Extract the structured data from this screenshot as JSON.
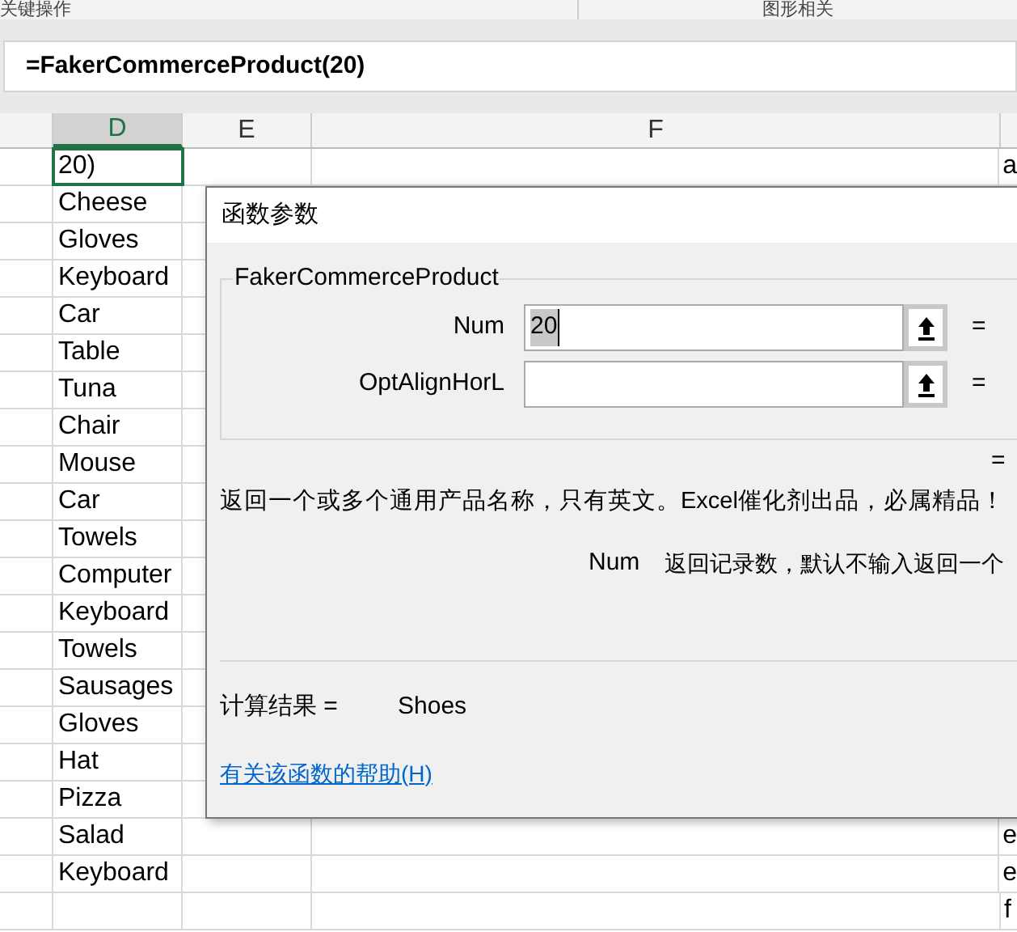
{
  "ribbon_groups": [
    "关键操作",
    "图形相关"
  ],
  "formula_bar": {
    "value": "=FakerCommerceProduct(20)"
  },
  "columns": [
    {
      "label": "D",
      "selected": true
    },
    {
      "label": "E",
      "selected": false
    },
    {
      "label": "F",
      "selected": false
    }
  ],
  "rows": [
    {
      "column_d": "20)",
      "column_g": "a",
      "selected": true
    },
    {
      "column_d": "Cheese",
      "selected": false
    },
    {
      "column_d": "Gloves",
      "selected": false
    },
    {
      "column_d": "Keyboard",
      "selected": false
    },
    {
      "column_d": "Car",
      "selected": false
    },
    {
      "column_d": "Table",
      "selected": false
    },
    {
      "column_d": "Tuna",
      "selected": false
    },
    {
      "column_d": "Chair",
      "selected": false
    },
    {
      "column_d": "Mouse",
      "selected": false
    },
    {
      "column_d": "Car",
      "selected": false
    },
    {
      "column_d": "Towels",
      "selected": false
    },
    {
      "column_d": "Computer",
      "selected": false
    },
    {
      "column_d": "Keyboard",
      "selected": false
    },
    {
      "column_d": "Towels",
      "selected": false
    },
    {
      "column_d": "Sausages",
      "selected": false
    },
    {
      "column_d": "Gloves",
      "selected": false
    },
    {
      "column_d": "Hat",
      "selected": false
    },
    {
      "column_d": "Pizza",
      "selected": false
    },
    {
      "column_d": "Salad",
      "column_g": "e",
      "selected": false
    },
    {
      "column_d": "Keyboard",
      "column_g": "e",
      "selected": false
    },
    {
      "column_g": "f",
      "selected": false
    }
  ],
  "dialog": {
    "title": "函数参数",
    "group_title": "FakerCommerceProduct",
    "arguments": [
      {
        "label": "Num",
        "value": "20",
        "value_selected": true,
        "equals": "="
      },
      {
        "label": "OptAlignHorL",
        "equals": "="
      }
    ],
    "result_equals": "=",
    "description": "返回一个或多个通用产品名称，只有英文。Excel催化剂出品，必属精品！",
    "argument_help": {
      "name": "Num",
      "text": "返回记录数，默认不输入返回一个"
    },
    "result": {
      "label": "计算结果 =",
      "value": "Shoes"
    },
    "help_link": "有关该函数的帮助(H)"
  }
}
